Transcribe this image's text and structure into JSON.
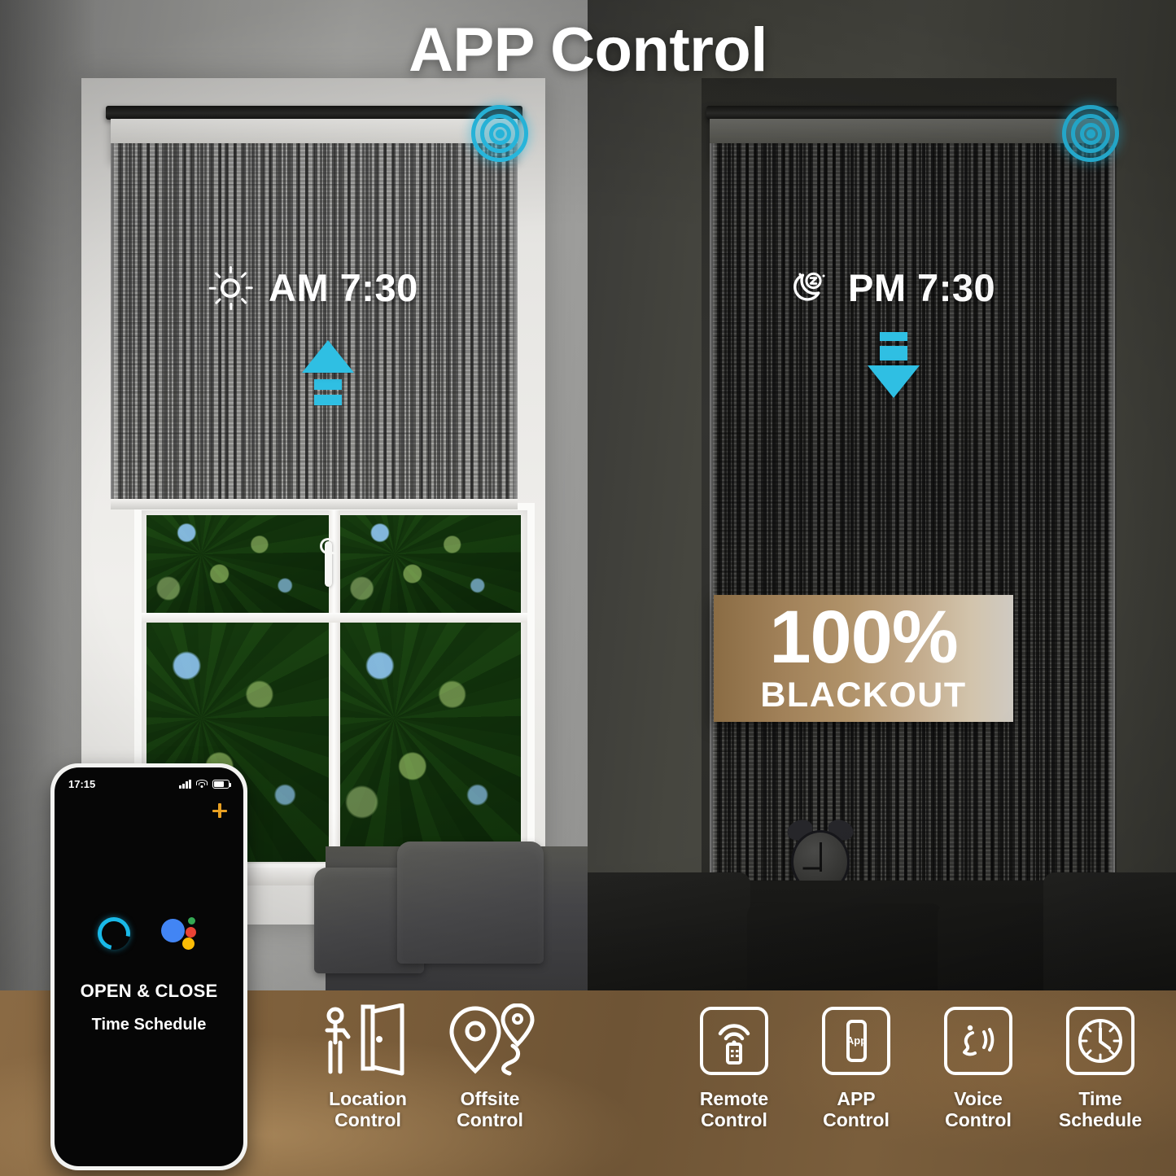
{
  "title": "APP Control",
  "left_panel": {
    "mode_icon": "sun-icon",
    "time_label": "AM 7:30",
    "arrow": "arrow-up-icon",
    "signal": "signal-rings-icon"
  },
  "right_panel": {
    "mode_icon": "moon-z-icon",
    "time_label": "PM 7:30",
    "arrow": "arrow-down-icon",
    "signal": "signal-rings-icon",
    "badge": {
      "percent": "100%",
      "label": "BLACKOUT"
    },
    "alarm_clock_icon": "alarm-clock-icon"
  },
  "phone": {
    "status_time": "17:15",
    "status_icons": [
      "signal-bars-icon",
      "wifi-icon",
      "battery-icon"
    ],
    "add_icon": "plus-icon",
    "assistants": [
      "alexa-icon",
      "google-assistant-icon"
    ],
    "heading": "OPEN & CLOSE",
    "subheading": "Time Schedule"
  },
  "features": [
    {
      "icon": "location-person-door-icon",
      "line1": "Location",
      "line2": "Control"
    },
    {
      "icon": "offsite-map-pins-icon",
      "line1": "Offsite",
      "line2": "Control"
    },
    {
      "icon": "remote-control-icon",
      "line1": "Remote",
      "line2": "Control"
    },
    {
      "icon": "app-phone-icon",
      "line1": "APP",
      "line2": "Control",
      "icon_text": "App"
    },
    {
      "icon": "voice-control-icon",
      "line1": "Voice",
      "line2": "Control"
    },
    {
      "icon": "clock-icon",
      "line1": "Time",
      "line2": "Schedule"
    }
  ],
  "colors": {
    "accent_cyan": "#2fbfe3",
    "signal_cyan": "#29c0e8",
    "band_brown": "#7d5f3b",
    "badge_wood": "#a08058",
    "text_white": "#ffffff",
    "phone_accent_orange": "#e8a022"
  }
}
